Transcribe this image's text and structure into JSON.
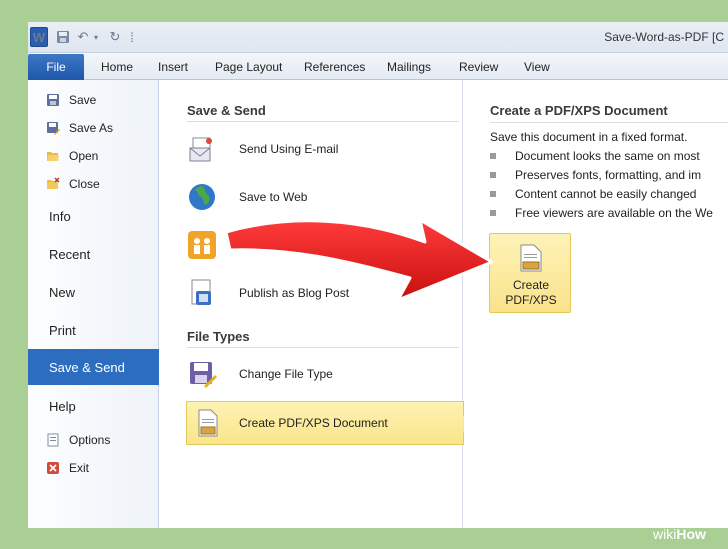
{
  "window": {
    "title": "Save-Word-as-PDF [C"
  },
  "quick_access": {
    "logo": "W",
    "undo": "↶",
    "redo": "↻",
    "customize": "⁞"
  },
  "ribbon": {
    "file_tab": "File",
    "tabs": [
      "Home",
      "Insert",
      "Page Layout",
      "References",
      "Mailings",
      "Review",
      "View"
    ]
  },
  "backstage_nav": {
    "save": "Save",
    "save_as": "Save As",
    "open": "Open",
    "close": "Close",
    "info": "Info",
    "recent": "Recent",
    "new": "New",
    "print": "Print",
    "save_send": "Save & Send",
    "help": "Help",
    "options": "Options",
    "exit": "Exit"
  },
  "save_send": {
    "section_title": "Save & Send",
    "send_email": "Send Using E-mail",
    "save_web": "Save to Web",
    "save_sharepoint": "Save to SharePoint",
    "publish_blog": "Publish as Blog Post",
    "file_types_title": "File Types",
    "change_file_type": "Change File Type",
    "create_pdf": "Create PDF/XPS Document"
  },
  "pdf_panel": {
    "title": "Create a PDF/XPS Document",
    "description": "Save this document in a fixed format.",
    "bullets": [
      "Document looks the same on most",
      "Preserves fonts, formatting, and im",
      "Content cannot be easily changed",
      "Free viewers are available on the We"
    ],
    "button_line1": "Create",
    "button_line2": "PDF/XPS"
  },
  "watermark": {
    "wiki": "wiki",
    "how": "How"
  },
  "colors": {
    "accent": "#2c6dc0",
    "highlight": "#fae58a",
    "arrow": "#e11a1a",
    "background": "#a9cf94"
  }
}
